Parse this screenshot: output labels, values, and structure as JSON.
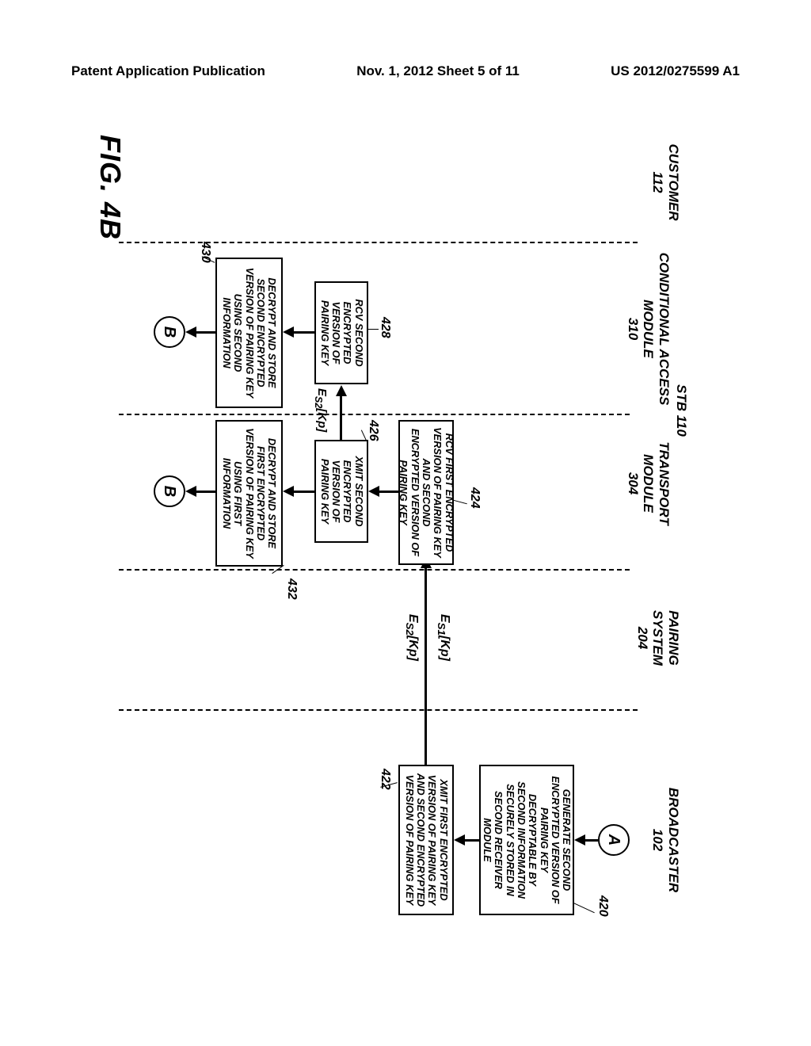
{
  "header": {
    "left": "Patent Application Publication",
    "center": "Nov. 1, 2012   Sheet 5 of 11",
    "right": "US 2012/0275599 A1"
  },
  "lanes": {
    "customer": {
      "label": "CUSTOMER",
      "ref": "112"
    },
    "cam": {
      "label": "CONDITIONAL ACCESS MODULE",
      "ref": "310"
    },
    "transport": {
      "label": "TRANSPORT MODULE",
      "ref": "304"
    },
    "pairing": {
      "label": "PAIRING SYSTEM",
      "ref": "204"
    },
    "broadcaster": {
      "label": "BROADCASTER",
      "ref": "102"
    },
    "stb_label": "STB 110"
  },
  "nodes": {
    "connA": "A",
    "box420": "GENERATE SECOND ENCRYPTED VERSION OF PAIRING KEY DECRYPTABLE BY SECOND INFORMATION SECURELY STORED IN SECOND RECEIVER MODULE",
    "ref420": "420",
    "box422": "XMIT FIRST ENCRYPTED VERSION OF PAIRING KEY AND SECOND ENCRYPTED VERSION OF PAIRING KEY",
    "ref422": "422",
    "msg1a": "E",
    "msg1a_sub": "S1",
    "msg1a_tail": "[Kp]",
    "msg1b": "E",
    "msg1b_sub": "S2",
    "msg1b_tail": "[Kp]",
    "box424": "RCV FIRST ENCRYPTED VERSION OF PAIRING KEY AND SECOND ENCRYPTED VERSION OF PAIRING KEY",
    "ref424": "424",
    "box426": "XMIT SECOND ENCRYPTED VERSION OF PAIRING KEY",
    "ref426": "426",
    "msg2": "E",
    "msg2_sub": "S2",
    "msg2_tail": "[Kp]",
    "box428": "RCV SECOND ENCRYPTED VERSION OF PAIRING KEY",
    "ref428": "428",
    "box430": "DECRYPT AND STORE SECOND ENCRYPTED VERSION OF PAIRING KEY USING SECOND INFORMATION",
    "ref430": "430",
    "box432": "DECRYPT AND STORE FIRST ENCRYPTED VERSION OF PAIRING KEY USING FIRST INFORMATION",
    "ref432": "432",
    "connB1": "B",
    "connB2": "B"
  },
  "figure": "FIG. 4B"
}
